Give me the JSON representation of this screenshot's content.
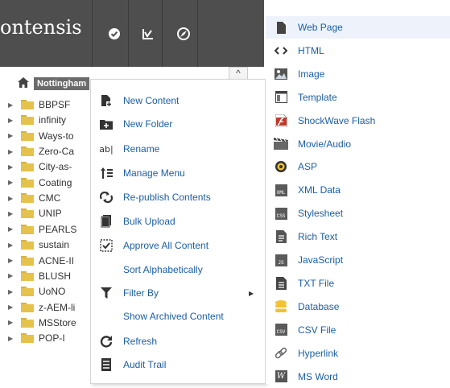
{
  "header": {
    "brand": "ontensis",
    "icons": [
      "check-circle-icon",
      "chart-icon",
      "compass-icon"
    ]
  },
  "tree": {
    "root_label": "Nottingham",
    "items": [
      "BBPSF",
      "infinity",
      "Ways-to",
      "Zero-Ca",
      "City-as-",
      "Coating",
      "CMC",
      "UNIP",
      "PEARLS",
      "sustain",
      "ACNE-II",
      "BLUSH",
      "UoNO",
      "z-AEM-li",
      "MSStore",
      "POP-I"
    ]
  },
  "context_menu": {
    "items": [
      {
        "label": "New Content",
        "icon": "new-content-icon"
      },
      {
        "label": "New Folder",
        "icon": "new-folder-icon"
      },
      {
        "label": "Rename",
        "icon": "rename-icon"
      },
      {
        "label": "Manage Menu",
        "icon": "manage-menu-icon"
      },
      {
        "label": "Re-publish Contents",
        "icon": "republish-icon"
      },
      {
        "label": "Bulk Upload",
        "icon": "bulk-upload-icon"
      },
      {
        "label": "Approve All Content",
        "icon": "approve-icon"
      },
      {
        "label": "Sort Alphabetically",
        "icon": ""
      },
      {
        "label": "Filter By",
        "icon": "filter-icon",
        "submenu": true
      },
      {
        "label": "Show Archived Content",
        "icon": ""
      },
      {
        "label": "Refresh",
        "icon": "refresh-icon"
      },
      {
        "label": "Audit Trail",
        "icon": "audit-trail-icon"
      }
    ]
  },
  "sub_menu": {
    "items": [
      {
        "label": "Web Page",
        "icon": "web-page-icon",
        "active": true
      },
      {
        "label": "HTML",
        "icon": "html-icon"
      },
      {
        "label": "Image",
        "icon": "image-icon"
      },
      {
        "label": "Template",
        "icon": "template-icon"
      },
      {
        "label": "ShockWave Flash",
        "icon": "flash-icon"
      },
      {
        "label": "Movie/Audio",
        "icon": "movie-icon"
      },
      {
        "label": "ASP",
        "icon": "asp-icon"
      },
      {
        "label": "XML Data",
        "icon": "xml-icon",
        "tag": "XML"
      },
      {
        "label": "Stylesheet",
        "icon": "stylesheet-icon",
        "tag": "CSS"
      },
      {
        "label": "Rich Text",
        "icon": "rich-text-icon"
      },
      {
        "label": "JavaScript",
        "icon": "javascript-icon",
        "tag": "JS"
      },
      {
        "label": "TXT File",
        "icon": "txt-file-icon"
      },
      {
        "label": "Database",
        "icon": "database-icon"
      },
      {
        "label": "CSV File",
        "icon": "csv-file-icon",
        "tag": "CSV"
      },
      {
        "label": "Hyperlink",
        "icon": "hyperlink-icon"
      },
      {
        "label": "MS Word",
        "icon": "ms-word-icon",
        "tag": "W"
      }
    ]
  },
  "colors": {
    "header_bg": "#4e4e4e",
    "link": "#1b5ea6",
    "folder": "#e5c24b",
    "db": "#f1c232",
    "flash": "#c0392b"
  }
}
